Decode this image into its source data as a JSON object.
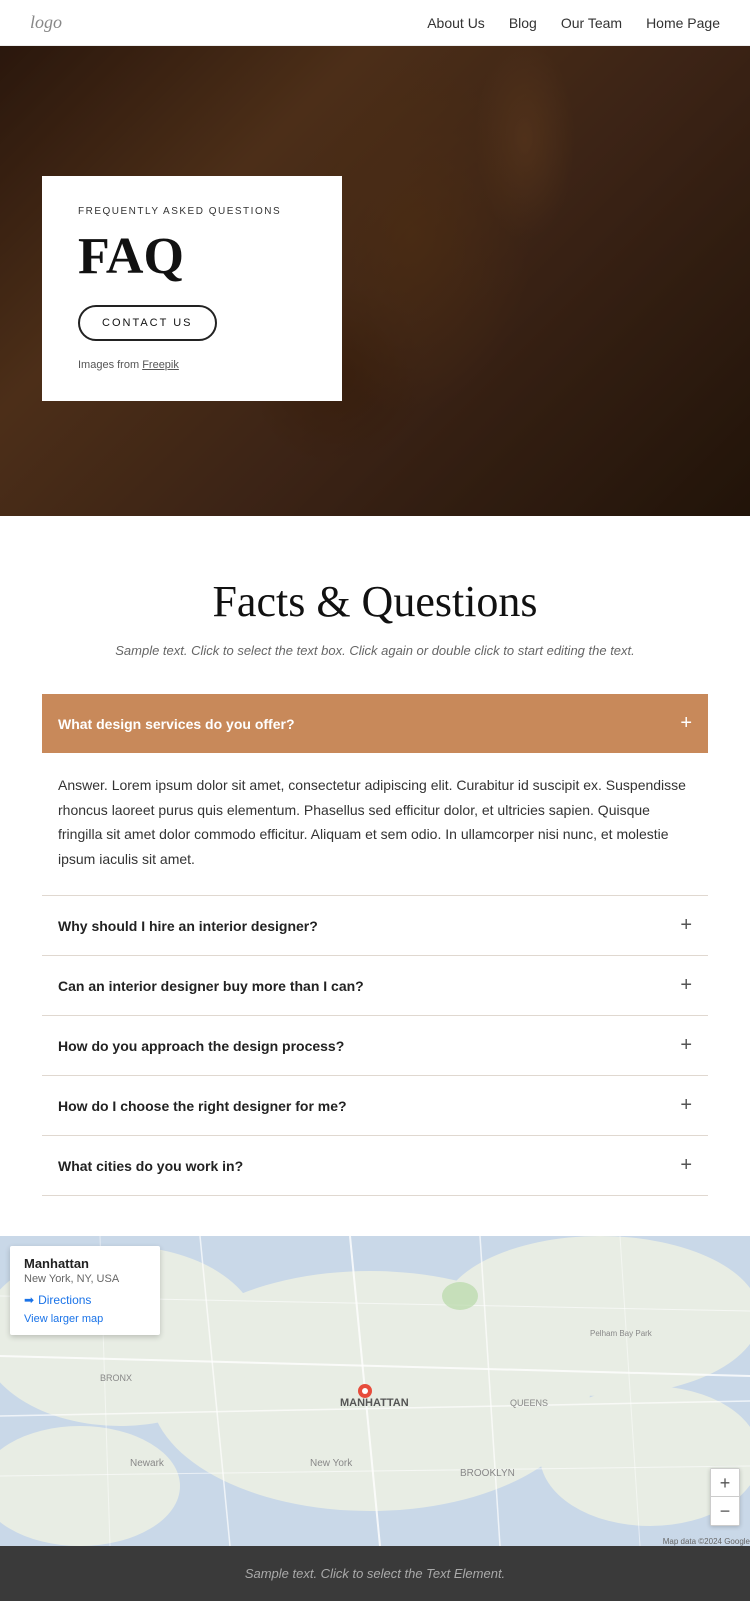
{
  "nav": {
    "logo": "logo",
    "links": [
      {
        "label": "About Us",
        "href": "#"
      },
      {
        "label": "Blog",
        "href": "#"
      },
      {
        "label": "Our Team",
        "href": "#"
      },
      {
        "label": "Home Page",
        "href": "#"
      }
    ]
  },
  "hero": {
    "subtitle": "Frequently Asked Questions",
    "title": "FAQ",
    "cta_label": "CONTACT US",
    "image_credit_prefix": "Images from ",
    "image_credit_link": "Freepik"
  },
  "faq_section": {
    "title": "Facts & Questions",
    "subtitle": "Sample text. Click to select the text box. Click again or double click to start editing the text.",
    "active_question": "What design services do you offer?",
    "active_answer": "Answer. Lorem ipsum dolor sit amet, consectetur adipiscing elit. Curabitur id suscipit ex. Suspendisse rhoncus laoreet purus quis elementum. Phasellus sed efficitur dolor, et ultricies sapien. Quisque fringilla sit amet dolor commodo efficitur. Aliquam et sem odio. In ullamcorper nisi nunc, et molestie ipsum iaculis sit amet.",
    "questions": [
      {
        "label": "Why should I hire an interior designer?"
      },
      {
        "label": "Can an interior designer buy more than I can?"
      },
      {
        "label": "How do you approach the design process?"
      },
      {
        "label": "How do I choose the right designer for me?"
      },
      {
        "label": "What cities do you work in?"
      }
    ]
  },
  "map": {
    "place_name": "Manhattan",
    "place_addr": "New York, NY, USA",
    "directions_label": "Directions",
    "view_larger_label": "View larger map",
    "zoom_in_label": "+",
    "zoom_out_label": "−"
  },
  "footer": {
    "text": "Sample text. Click to select the Text Element."
  }
}
